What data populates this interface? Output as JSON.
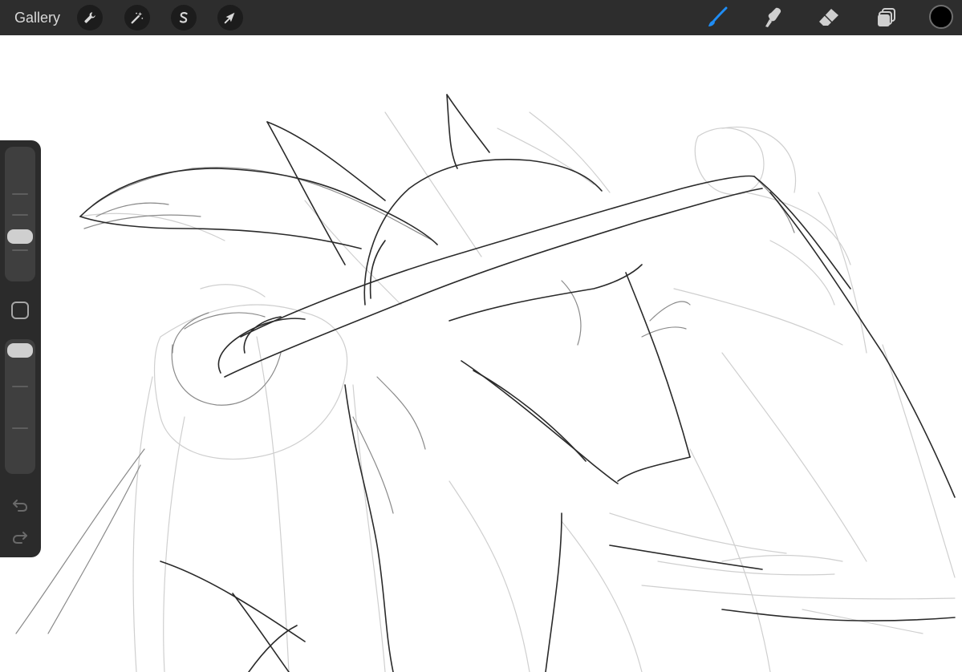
{
  "topbar": {
    "gallery_label": "Gallery",
    "actions_icon": "wrench-icon",
    "adjustments_icon": "magic-wand-icon",
    "selection_icon": "selection-s-icon",
    "transform_icon": "arrow-cursor-icon",
    "brush_icon": "brush-icon",
    "smudge_icon": "smudge-icon",
    "eraser_icon": "eraser-icon",
    "layers_icon": "layers-icon",
    "active_tool": "brush",
    "active_color": "#000000",
    "accent_color": "#1f8df5",
    "bar_color": "#2d2d2d"
  },
  "sidebar": {
    "brush_size_level": 0.62,
    "opacity_level": 0.95,
    "modify_icon": "square-icon",
    "undo_icon": "undo-icon",
    "redo_icon": "redo-icon"
  }
}
